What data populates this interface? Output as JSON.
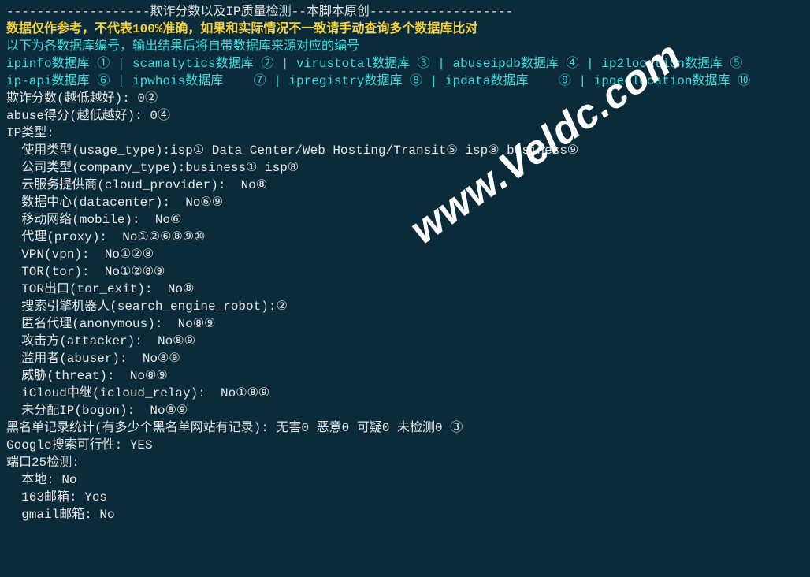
{
  "header_line": "-------------------欺诈分数以及IP质量检测--本脚本原创-------------------",
  "warning": "数据仅作参考，不代表100%准确，如果和实际情况不一致请手动查询多个数据库比对",
  "note": "以下为各数据库编号，输出结果后将自带数据库来源对应的编号",
  "db_line1": "ipinfo数据库 ① | scamalytics数据库 ② | virustotal数据库 ③ | abuseipdb数据库 ④ | ip2location数据库 ⑤",
  "db_line2": "ip-api数据库 ⑥ | ipwhois数据库    ⑦ | ipregistry数据库 ⑧ | ipdata数据库    ⑨ | ipgeolocation数据库 ⑩",
  "fraud_score": "欺诈分数(越低越好): 0②",
  "abuse_score": "abuse得分(越低越好): 0④",
  "ip_type_header": "IP类型:",
  "usage_type": "  使用类型(usage_type):isp① Data Center/Web Hosting/Transit⑤ isp⑧ business⑨",
  "company_type": "  公司类型(company_type):business① isp⑧",
  "cloud_provider": "  云服务提供商(cloud_provider):  No⑧",
  "datacenter": "  数据中心(datacenter):  No⑥⑨",
  "mobile": "  移动网络(mobile):  No⑥",
  "proxy": "  代理(proxy):  No①②⑥⑧⑨⑩",
  "vpn": "  VPN(vpn):  No①②⑧",
  "tor": "  TOR(tor):  No①②⑧⑨",
  "tor_exit": "  TOR出口(tor_exit):  No⑧",
  "search_robot": "  搜索引擎机器人(search_engine_robot):②",
  "anonymous": "  匿名代理(anonymous):  No⑧⑨",
  "attacker": "  攻击方(attacker):  No⑧⑨",
  "abuser": "  滥用者(abuser):  No⑧⑨",
  "threat": "  威胁(threat):  No⑧⑨",
  "icloud_relay": "  iCloud中继(icloud_relay):  No①⑧⑨",
  "bogon": "  未分配IP(bogon):  No⑧⑨",
  "blacklist": "黑名单记录统计(有多少个黑名单网站有记录): 无害0 恶意0 可疑0 未检测0 ③",
  "google": "Google搜索可行性: YES",
  "port25_header": "端口25检测:",
  "port25_local": "  本地: No",
  "port25_163": "  163邮箱: Yes",
  "port25_gmail": "  gmail邮箱: No",
  "watermark": "www.Veldc.com"
}
